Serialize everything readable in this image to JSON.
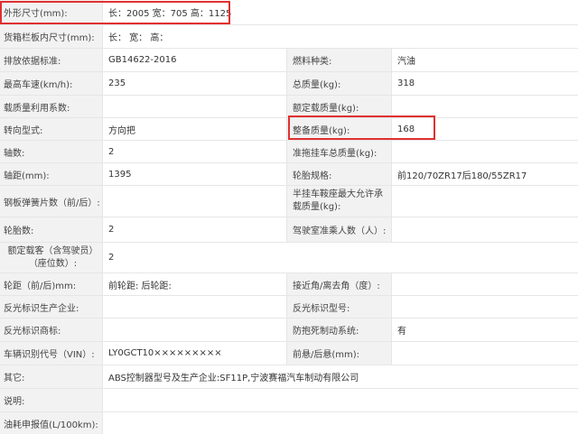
{
  "rows": [
    {
      "l1": "外形尺寸(mm):",
      "v1": "长：2005 宽：705 高：1125",
      "l2": "",
      "v2": ""
    },
    {
      "l1": "货箱栏板内尺寸(mm):",
      "v1": "长： 宽： 高：",
      "l2": "",
      "v2": ""
    },
    {
      "l1": "排放依据标准:",
      "v1": "GB14622-2016",
      "l2": "燃料种类:",
      "v2": "汽油"
    },
    {
      "l1": "最高车速(km/h):",
      "v1": "235",
      "l2": "总质量(kg):",
      "v2": "318"
    },
    {
      "l1": "载质量利用系数:",
      "v1": "",
      "l2": "额定载质量(kg):",
      "v2": ""
    },
    {
      "l1": "转向型式:",
      "v1": "方向把",
      "l2": "整备质量(kg):",
      "v2": "168"
    },
    {
      "l1": "轴数:",
      "v1": "2",
      "l2": "准拖挂车总质量(kg):",
      "v2": ""
    },
    {
      "l1": "轴距(mm):",
      "v1": "1395",
      "l2": "轮胎规格:",
      "v2": "前120/70ZR17后180/55ZR17"
    },
    {
      "l1": "钢板弹簧片数（前/后）:",
      "v1": "",
      "l2": "半挂车鞍座最大允许承载质量(kg):",
      "v2": ""
    },
    {
      "l1": "轮胎数:",
      "v1": "2",
      "l2": "驾驶室准乘人数（人）:",
      "v2": ""
    },
    {
      "l1": "额定载客（含驾驶员）（座位数）:",
      "v1": "2",
      "l2": "",
      "v2": ""
    },
    {
      "l1": "轮距（前/后)mm:",
      "v1": "前轮距: 后轮距:",
      "l2": "接近角/离去角（度）:",
      "v2": ""
    },
    {
      "l1": "反光标识生产企业:",
      "v1": "",
      "l2": "反光标识型号:",
      "v2": ""
    },
    {
      "l1": "反光标识商标:",
      "v1": "",
      "l2": "防抱死制动系统:",
      "v2": "有"
    },
    {
      "l1": "车辆识别代号（VIN）:",
      "v1": "LY0GCT10×××××××××",
      "l2": "前悬/后悬(mm):",
      "v2": ""
    },
    {
      "l1": "其它:",
      "v1": "ABS控制器型号及生产企业:SF11P,宁波赛福汽车制动有限公司",
      "l2": "",
      "v2": ""
    },
    {
      "l1": "说明:",
      "v1": "",
      "l2": "",
      "v2": ""
    },
    {
      "l1": "油耗申报值(L/100km):",
      "v1": "",
      "l2": "",
      "v2": ""
    }
  ],
  "highlight_color": "#e03030",
  "label_bg": "#f2f2f2"
}
